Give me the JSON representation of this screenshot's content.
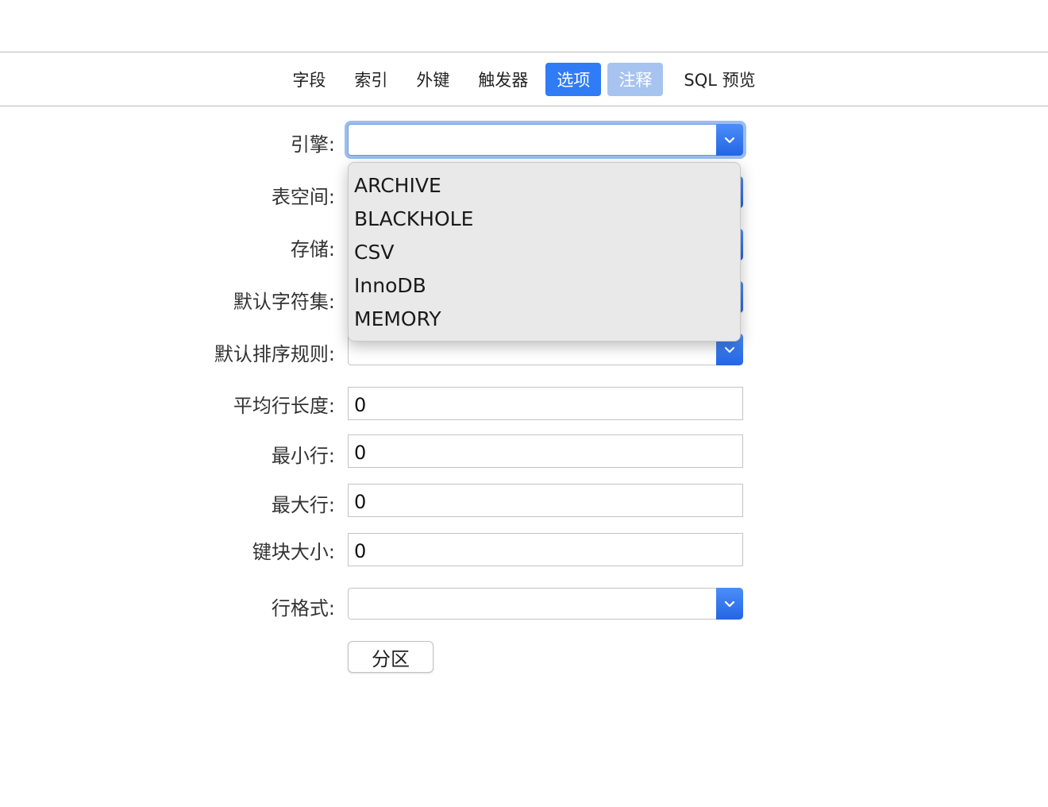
{
  "tabs": [
    {
      "label": "字段",
      "state": "normal"
    },
    {
      "label": "索引",
      "state": "normal"
    },
    {
      "label": "外键",
      "state": "normal"
    },
    {
      "label": "触发器",
      "state": "normal"
    },
    {
      "label": "选项",
      "state": "active"
    },
    {
      "label": "注释",
      "state": "hover"
    },
    {
      "label": "SQL 预览",
      "state": "normal"
    }
  ],
  "form": {
    "engine": {
      "label": "引擎:",
      "value": ""
    },
    "tablespace": {
      "label": "表空间:",
      "value": ""
    },
    "storage": {
      "label": "存储:",
      "value": ""
    },
    "default_charset": {
      "label": "默认字符集:",
      "value": ""
    },
    "default_collation": {
      "label": "默认排序规则:",
      "value": ""
    },
    "avg_row_length": {
      "label": "平均行长度:",
      "value": "0"
    },
    "min_rows": {
      "label": "最小行:",
      "value": "0"
    },
    "max_rows": {
      "label": "最大行:",
      "value": "0"
    },
    "key_block_size": {
      "label": "键块大小:",
      "value": "0"
    },
    "row_format": {
      "label": "行格式:",
      "value": ""
    },
    "partition_button": "分区"
  },
  "engine_dropdown": {
    "open": true,
    "options": [
      "ARCHIVE",
      "BLACKHOLE",
      "CSV",
      "InnoDB",
      "MEMORY"
    ]
  },
  "colors": {
    "accent": "#2f7cf6",
    "hover_tab": "#a7c4f0",
    "focus_ring": "#9cbcf1"
  }
}
